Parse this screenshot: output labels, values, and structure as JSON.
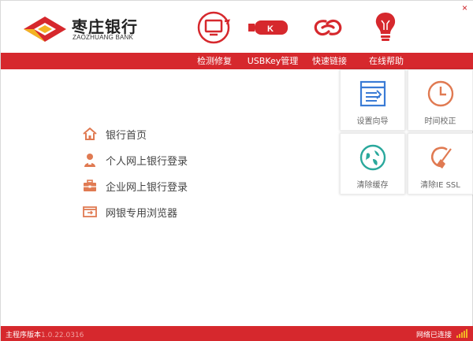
{
  "app": {
    "brand_cn": "枣庄银行",
    "brand_en": "ZAOZHUANG BANK",
    "close_glyph": "×"
  },
  "colors": {
    "brand_red": "#d6282d",
    "icon_orange": "#e07a52",
    "teal": "#2aa89c",
    "blue": "#3a7bd5"
  },
  "toolbar": [
    {
      "label": "检测修复",
      "icon": "monitor-repair-icon"
    },
    {
      "label": "USBKey管理",
      "icon": "usbkey-icon"
    },
    {
      "label": "快速链接",
      "icon": "link-icon"
    },
    {
      "label": "在线帮助",
      "icon": "lightbulb-icon"
    }
  ],
  "usbkey_letter": "K",
  "links": [
    {
      "label": "银行首页",
      "icon": "home-icon"
    },
    {
      "label": "个人网上银行登录",
      "icon": "person-icon"
    },
    {
      "label": "企业网上银行登录",
      "icon": "briefcase-icon"
    },
    {
      "label": "网银专用浏览器",
      "icon": "browser-icon"
    }
  ],
  "tiles": [
    {
      "label": "设置向导",
      "icon": "setup-wizard-icon"
    },
    {
      "label": "时间校正",
      "icon": "clock-icon"
    },
    {
      "label": "清除缓存",
      "icon": "clear-cache-icon"
    },
    {
      "label": "清除IE SSL",
      "icon": "clear-ssl-icon"
    }
  ],
  "status": {
    "version_label": "主程序版本",
    "version_value": "1.0.22.0316",
    "network": "网络已连接"
  }
}
